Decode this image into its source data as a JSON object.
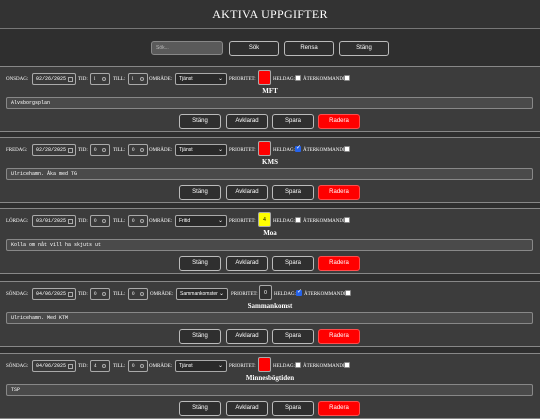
{
  "header": {
    "title": "AKTIVA UPPGIFTER"
  },
  "toolbar": {
    "search_placeholder": "Sök...",
    "search_label": "Sök",
    "reset_label": "Rensa",
    "close_label": "Stäng"
  },
  "labels": {
    "time": "TID:",
    "until": "TILL:",
    "area": "OMRÅDE:",
    "priority": "PRIORITET:",
    "allday": "HELDAG:",
    "recurring": "ÅTERKOMMANDE:",
    "close": "Stäng",
    "done": "Avklarad",
    "save": "Spara",
    "delete": "Radera"
  },
  "tasks": [
    {
      "day": "ONSDAG:",
      "date": "02/26/2025",
      "from": "l",
      "to": "l",
      "area": "Tjänst",
      "priority_value": "",
      "priority_color": "#ff0000",
      "allday": false,
      "recurring": false,
      "title": "MFT",
      "note": "Alvsborgsplan"
    },
    {
      "day": "FREDAG:",
      "date": "02/28/2025",
      "from": "0",
      "to": "0",
      "area": "Tjänst",
      "priority_value": "",
      "priority_color": "#ff0000",
      "allday": true,
      "recurring": false,
      "title": "KMS",
      "note": "Ulricehamn. Åka med TG"
    },
    {
      "day": "LÖRDAG:",
      "date": "03/01/2025",
      "from": "0",
      "to": "0",
      "area": "Fritid",
      "priority_value": "4",
      "priority_color": "#ffff00",
      "allday": false,
      "recurring": false,
      "title": "Moa",
      "note": "Kolla om nåt vill ha skjuts ut"
    },
    {
      "day": "SÖNDAG:",
      "date": "04/06/2025",
      "from": "0",
      "to": "0",
      "area": "Sammankomster",
      "priority_value": "0",
      "priority_color": "#2f2f2f",
      "allday": true,
      "recurring": false,
      "title": "Sammankomst",
      "note": "Ulricehamn. Med KTM"
    },
    {
      "day": "SÖNDAG:",
      "date": "04/06/2025",
      "from": "4",
      "to": "0",
      "area": "Tjänst",
      "priority_value": "",
      "priority_color": "#ff0000",
      "allday": false,
      "recurring": false,
      "title": "Minnesbögtiden",
      "note": "TSP"
    }
  ]
}
